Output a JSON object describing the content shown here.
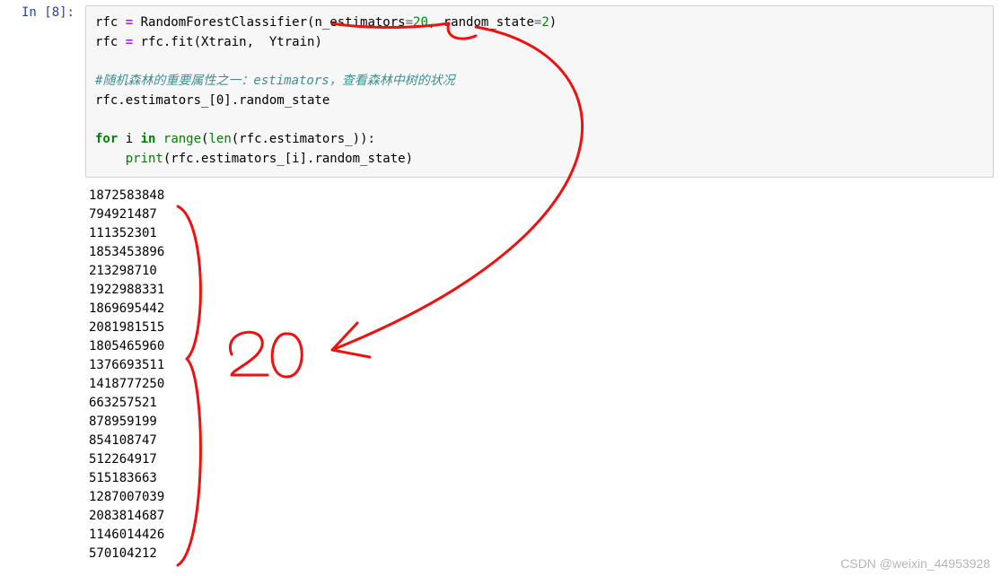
{
  "prompt": {
    "label": "In  [8]:"
  },
  "code": {
    "l1": {
      "a": "rfc ",
      "op": "=",
      "b": " RandomForestClassifier(n_estimators",
      "eq1": "=",
      "n1": "20",
      "c": ", random_state",
      "eq2": "=",
      "n2": "2",
      "d": ")"
    },
    "l2": {
      "a": "rfc ",
      "op": "=",
      "b": " rfc.fit(Xtrain,  Ytrain)"
    },
    "blank1": "",
    "comment": "#随机森林的重要属性之一：estimators，查看森林中树的状况",
    "l4": "rfc.estimators_[0].random_state",
    "blank2": "",
    "l6": {
      "kw_for": "for",
      "a": " i ",
      "kw_in": "in",
      "b": " ",
      "range": "range",
      "c": "(",
      "len": "len",
      "d": "(rfc.estimators_)):"
    },
    "l7": {
      "indent": "    ",
      "print": "print",
      "rest": "(rfc.estimators_[i].random_state)"
    }
  },
  "output": [
    "1872583848",
    "794921487",
    "111352301",
    "1853453896",
    "213298710",
    "1922988331",
    "1869695442",
    "2081981515",
    "1805465960",
    "1376693511",
    "1418777250",
    "663257521",
    "878959199",
    "854108747",
    "512264917",
    "515183663",
    "1287007039",
    "2083814687",
    "1146014426",
    "570104212"
  ],
  "annotation": {
    "handwritten_label": "20"
  },
  "watermark": "CSDN @weixin_44953928"
}
